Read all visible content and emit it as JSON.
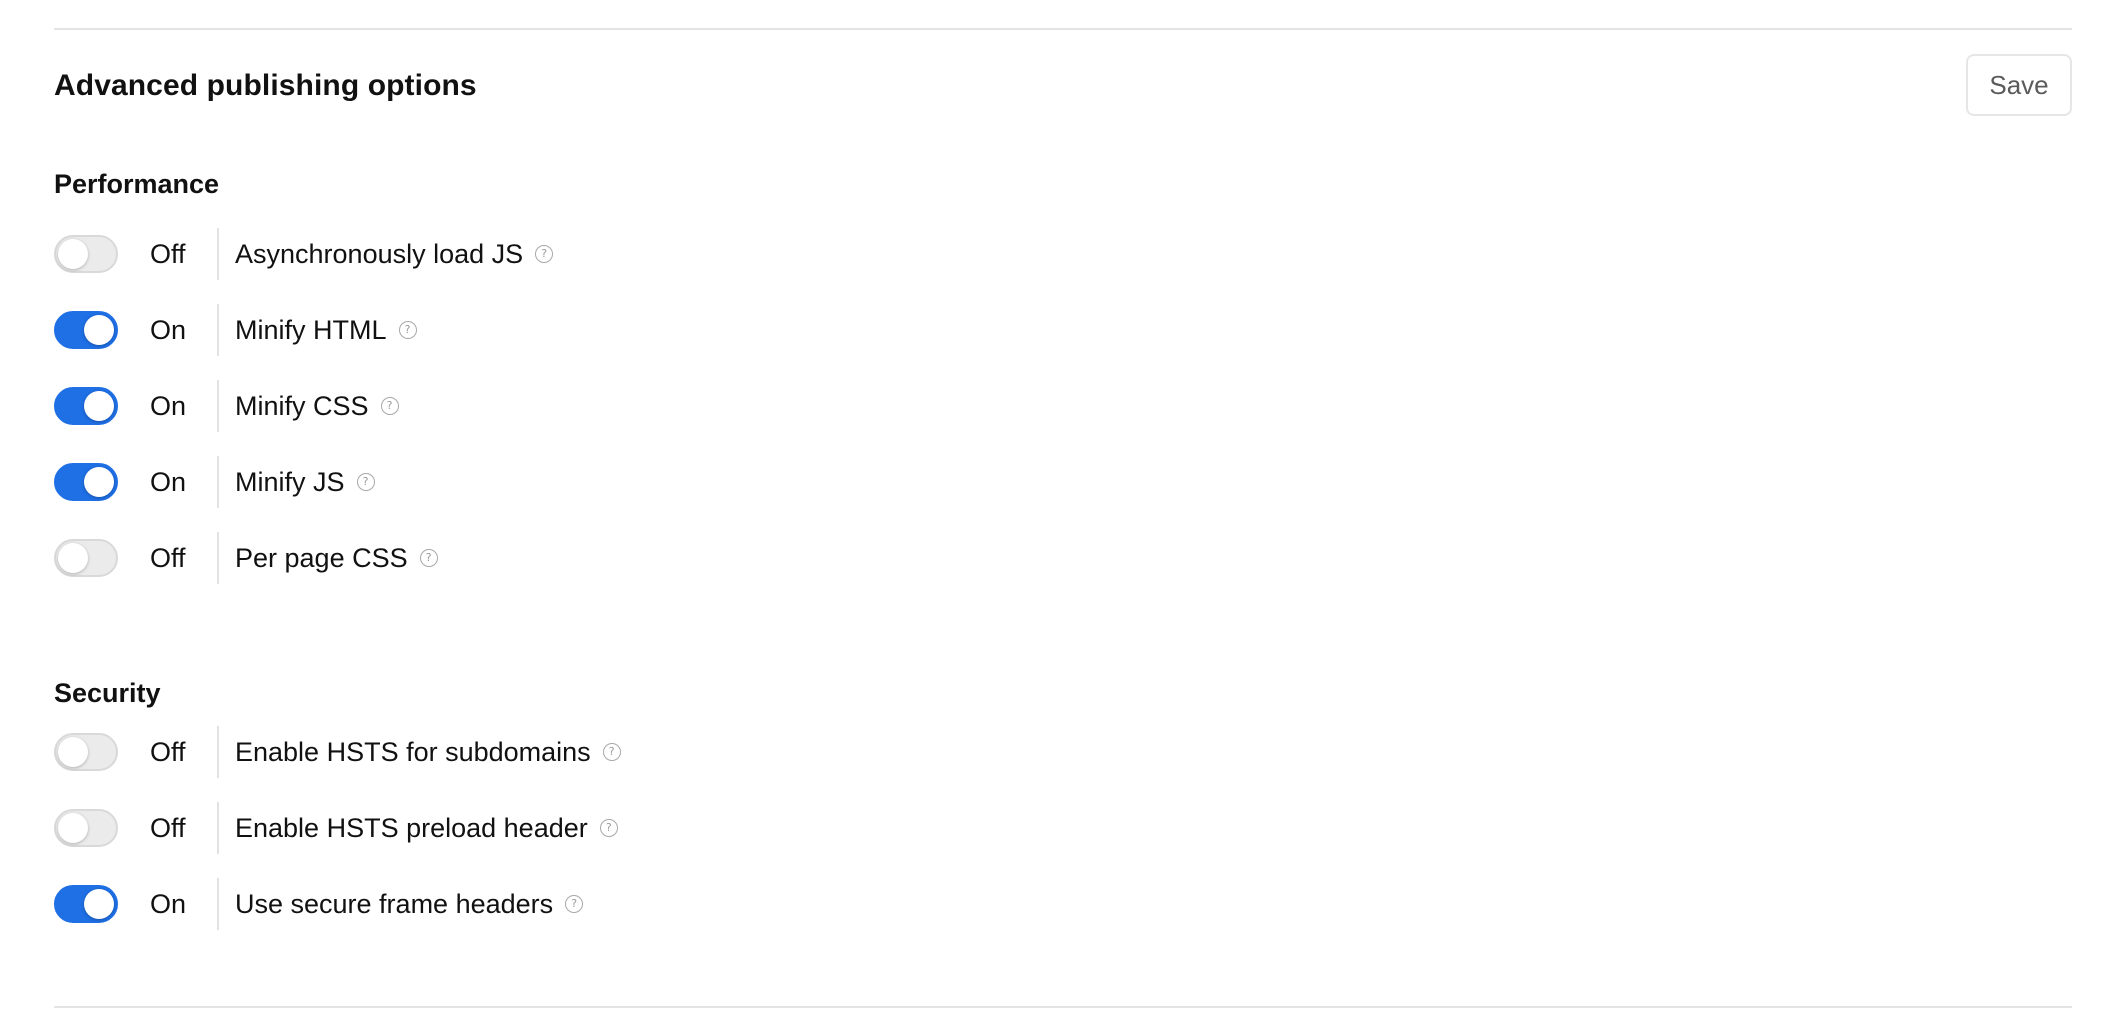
{
  "header": {
    "title": "Advanced publishing options",
    "save_label": "Save"
  },
  "help_icon": "question-circle-icon",
  "colors": {
    "toggle_on": "#1f6fe5",
    "toggle_off": "#ebebeb"
  },
  "sections": [
    {
      "title": "Performance",
      "options": [
        {
          "label": "Asynchronously load JS",
          "state": "Off",
          "enabled": false
        },
        {
          "label": "Minify HTML",
          "state": "On",
          "enabled": true
        },
        {
          "label": "Minify CSS",
          "state": "On",
          "enabled": true
        },
        {
          "label": "Minify JS",
          "state": "On",
          "enabled": true
        },
        {
          "label": "Per page CSS",
          "state": "Off",
          "enabled": false
        }
      ]
    },
    {
      "title": "Security",
      "options": [
        {
          "label": "Enable HSTS for subdomains",
          "state": "Off",
          "enabled": false
        },
        {
          "label": "Enable HSTS preload header",
          "state": "Off",
          "enabled": false
        },
        {
          "label": "Use secure frame headers",
          "state": "On",
          "enabled": true
        }
      ]
    }
  ]
}
